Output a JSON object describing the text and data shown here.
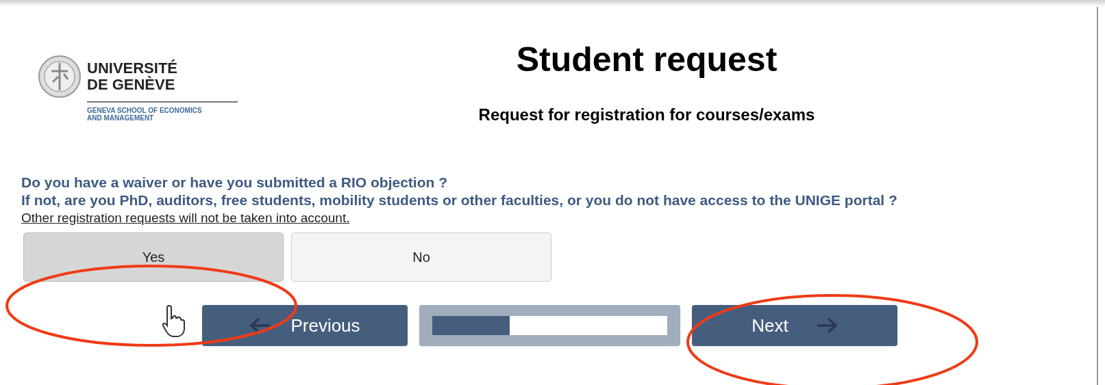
{
  "logo": {
    "name_lines": [
      "UNIVERSITÉ",
      "DE GENÈVE"
    ],
    "school_lines": [
      "GENEVA SCHOOL OF ECONOMICS",
      "AND MANAGEMENT"
    ]
  },
  "title": "Student request",
  "subtitle": "Request for registration for courses/exams",
  "question": [
    "Do you have a waiver or have you submitted a RIO objection ?",
    "If not, are you PhD, auditors, free students, mobility students or other faculties, or you do not have access to the UNIGE portal ?"
  ],
  "note": "Other registration requests will not be taken into account.",
  "choices": [
    {
      "label": "Yes",
      "selected": true
    },
    {
      "label": "No",
      "selected": false
    }
  ],
  "nav": {
    "previous": "Previous",
    "next": "Next",
    "progress": {
      "level": 0.33
    }
  }
}
